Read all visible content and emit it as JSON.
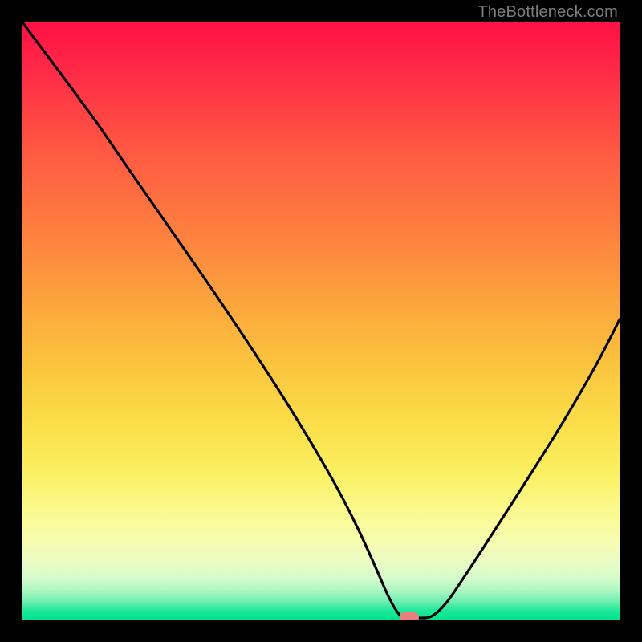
{
  "watermark": {
    "text": "TheBottleneck.com"
  },
  "chart_data": {
    "type": "line",
    "title": "",
    "xlabel": "",
    "ylabel": "",
    "xlim": [
      0,
      100
    ],
    "ylim": [
      0,
      100
    ],
    "grid": false,
    "legend": false,
    "series": [
      {
        "name": "bottleneck-curve",
        "color": "#000000",
        "x": [
          0,
          6,
          12,
          18,
          24,
          30,
          36,
          42,
          48,
          53,
          57,
          60,
          62,
          64,
          68,
          74,
          80,
          86,
          92,
          100
        ],
        "y": [
          100,
          93,
          86,
          79,
          71,
          63,
          54,
          45,
          35,
          24,
          14,
          6,
          1,
          0,
          0,
          6,
          16,
          27,
          38,
          55
        ]
      }
    ],
    "marker": {
      "name": "optimal-point",
      "x": 64,
      "y": 0,
      "color": "#e97f7e"
    },
    "background_gradient": {
      "stops": [
        {
          "pos": 0,
          "color": "#ff1145"
        },
        {
          "pos": 50,
          "color": "#fca23d"
        },
        {
          "pos": 80,
          "color": "#fbf165"
        },
        {
          "pos": 100,
          "color": "#00e28e"
        }
      ]
    }
  }
}
